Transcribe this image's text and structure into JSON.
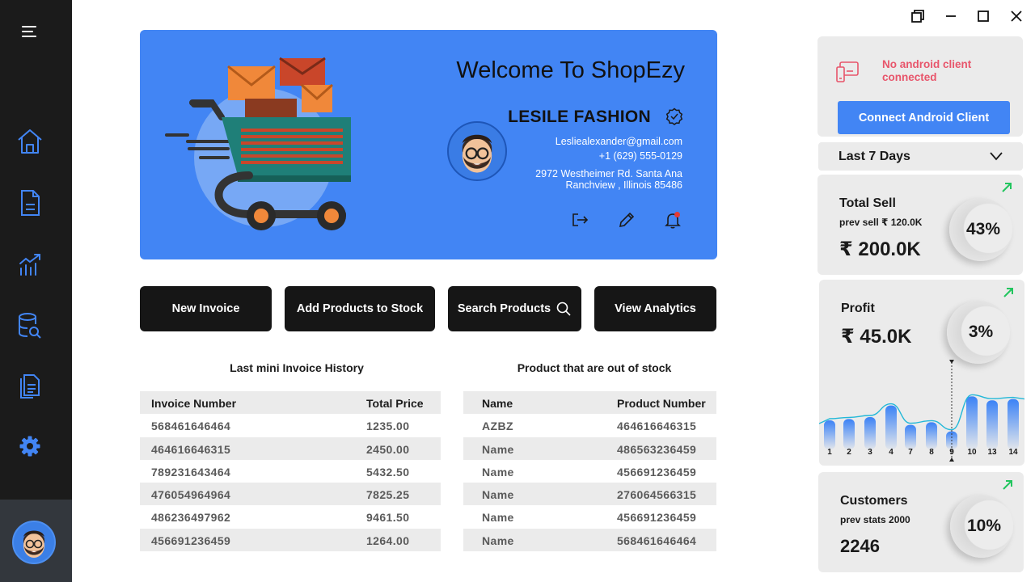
{
  "sidebar": {
    "items": [
      {
        "icon": "menu-icon"
      },
      {
        "icon": "home-icon"
      },
      {
        "icon": "document-icon"
      },
      {
        "icon": "analytics-icon"
      },
      {
        "icon": "database-search-icon"
      },
      {
        "icon": "documents-icon"
      },
      {
        "icon": "settings-icon"
      }
    ]
  },
  "window_controls": [
    "restore-icon",
    "minimize-icon",
    "maximize-icon",
    "close-icon"
  ],
  "banner": {
    "welcome": "Welcome To ShopEzy",
    "store_name": "LESILE FASHION",
    "email": "Lesliealexander@gmail.com",
    "phone": "+1 (629) 555-0129",
    "address_line1": "2972 Westheimer Rd. Santa Ana",
    "address_line2": "Ranchview , Illinois 85486"
  },
  "actions": {
    "new_invoice": "New Invoice",
    "add_products": "Add Products to Stock",
    "search_products": "Search Products",
    "view_analytics": "View Analytics"
  },
  "invoice_table": {
    "title": "Last mini Invoice History",
    "headers": [
      "Invoice Number",
      "Total Price"
    ],
    "rows": [
      [
        "568461646464",
        "1235.00"
      ],
      [
        "464616646315",
        "2450.00"
      ],
      [
        "789231643464",
        "5432.50"
      ],
      [
        "476054964964",
        "7825.25"
      ],
      [
        "486236497962",
        "9461.50"
      ],
      [
        "456691236459",
        "1264.00"
      ]
    ]
  },
  "stock_table": {
    "title": "Product that are out of stock",
    "headers": [
      "Name",
      "Product Number"
    ],
    "rows": [
      [
        "AZBZ",
        "464616646315"
      ],
      [
        "Name",
        "486563236459"
      ],
      [
        "Name",
        "456691236459"
      ],
      [
        "Name",
        "276064566315"
      ],
      [
        "Name",
        "456691236459"
      ],
      [
        "Name",
        "568461646464"
      ]
    ]
  },
  "android": {
    "status": "No android client connected",
    "button": "Connect Android Client"
  },
  "period": {
    "selected": "Last 7 Days"
  },
  "stats": {
    "total_sell": {
      "title": "Total Sell",
      "prev": "prev  sell ₹ 120.0K",
      "value": "₹ 200.0K",
      "percent": "43%"
    },
    "profit": {
      "title": "Profit",
      "value": "₹ 45.0K",
      "percent": "3%"
    },
    "customers": {
      "title": "Customers",
      "prev": "prev stats 2000",
      "value": "2246",
      "percent": "10%"
    }
  },
  "colors": {
    "accent": "#4285f4",
    "sidebar": "#1b1b1b",
    "alert": "#e8556b",
    "trend_up": "#22c55e"
  },
  "chart_data": {
    "type": "bar",
    "categories": [
      "1",
      "2",
      "3",
      "4",
      "7",
      "8",
      "9",
      "10",
      "13",
      "14"
    ],
    "values": [
      45,
      47,
      50,
      68,
      38,
      42,
      28,
      82,
      76,
      78
    ],
    "ylim": [
      0,
      100
    ],
    "grid": false,
    "highlight_index": 6
  }
}
